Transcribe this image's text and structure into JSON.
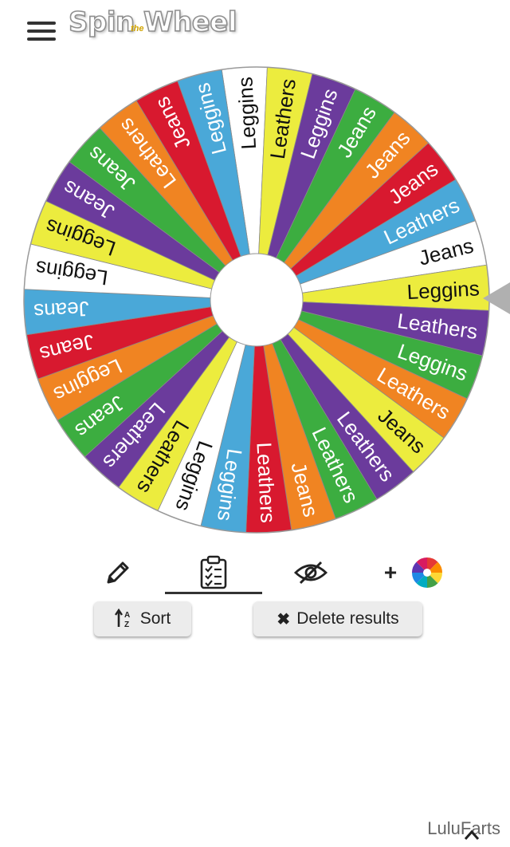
{
  "header": {
    "logo_text": "Spin Wheel",
    "logo_small": "the",
    "menu_icon": "hamburger-menu-icon"
  },
  "wheel": {
    "segments": [
      {
        "label": "Leggins",
        "color": "#ffffff"
      },
      {
        "label": "Leathers",
        "color": "#ecec3e"
      },
      {
        "label": "Leggins",
        "color": "#6b3b9c"
      },
      {
        "label": "Jeans",
        "color": "#3cad40"
      },
      {
        "label": "Jeans",
        "color": "#f08422"
      },
      {
        "label": "Jeans",
        "color": "#d8192f"
      },
      {
        "label": "Leathers",
        "color": "#4aa8d8"
      },
      {
        "label": "Jeans",
        "color": "#ffffff"
      },
      {
        "label": "Leggins",
        "color": "#ecec3e"
      },
      {
        "label": "Leathers",
        "color": "#6b3b9c"
      },
      {
        "label": "Leggins",
        "color": "#3cad40"
      },
      {
        "label": "Leathers",
        "color": "#f08422"
      },
      {
        "label": "Jeans",
        "color": "#ecec3e"
      },
      {
        "label": "Leathers",
        "color": "#6b3b9c"
      },
      {
        "label": "Leathers",
        "color": "#3cad40"
      },
      {
        "label": "Jeans",
        "color": "#f08422"
      },
      {
        "label": "Leathers",
        "color": "#d8192f"
      },
      {
        "label": "Leggins",
        "color": "#4aa8d8"
      },
      {
        "label": "Leggins",
        "color": "#ffffff"
      },
      {
        "label": "Leathers",
        "color": "#ecec3e"
      },
      {
        "label": "Leathers",
        "color": "#6b3b9c"
      },
      {
        "label": "Jeans",
        "color": "#3cad40"
      },
      {
        "label": "Leggins",
        "color": "#f08422"
      },
      {
        "label": "Jeans",
        "color": "#d8192f"
      },
      {
        "label": "Jeans",
        "color": "#4aa8d8"
      },
      {
        "label": "Leggins",
        "color": "#ffffff"
      },
      {
        "label": "Leggins",
        "color": "#ecec3e"
      },
      {
        "label": "Jeans",
        "color": "#6b3b9c"
      },
      {
        "label": "Jeans",
        "color": "#3cad40"
      },
      {
        "label": "Leathers",
        "color": "#f08422"
      },
      {
        "label": "Jeans",
        "color": "#d8192f"
      },
      {
        "label": "Leggins",
        "color": "#4aa8d8"
      }
    ],
    "pointer_color": "#b0b0b0"
  },
  "toolbar": {
    "edit_icon": "pencil-icon",
    "results_icon": "clipboard-list-icon",
    "hide_icon": "eye-slash-icon",
    "add_label": "+",
    "color_icon": "color-wheel-icon"
  },
  "actions": {
    "sort_label": "Sort",
    "sort_icon": "sort-az-icon",
    "delete_label": "Delete results",
    "delete_icon": "close-x-icon"
  },
  "watermark": "LuluFarts",
  "chevron_icon": "chevron-up-icon"
}
